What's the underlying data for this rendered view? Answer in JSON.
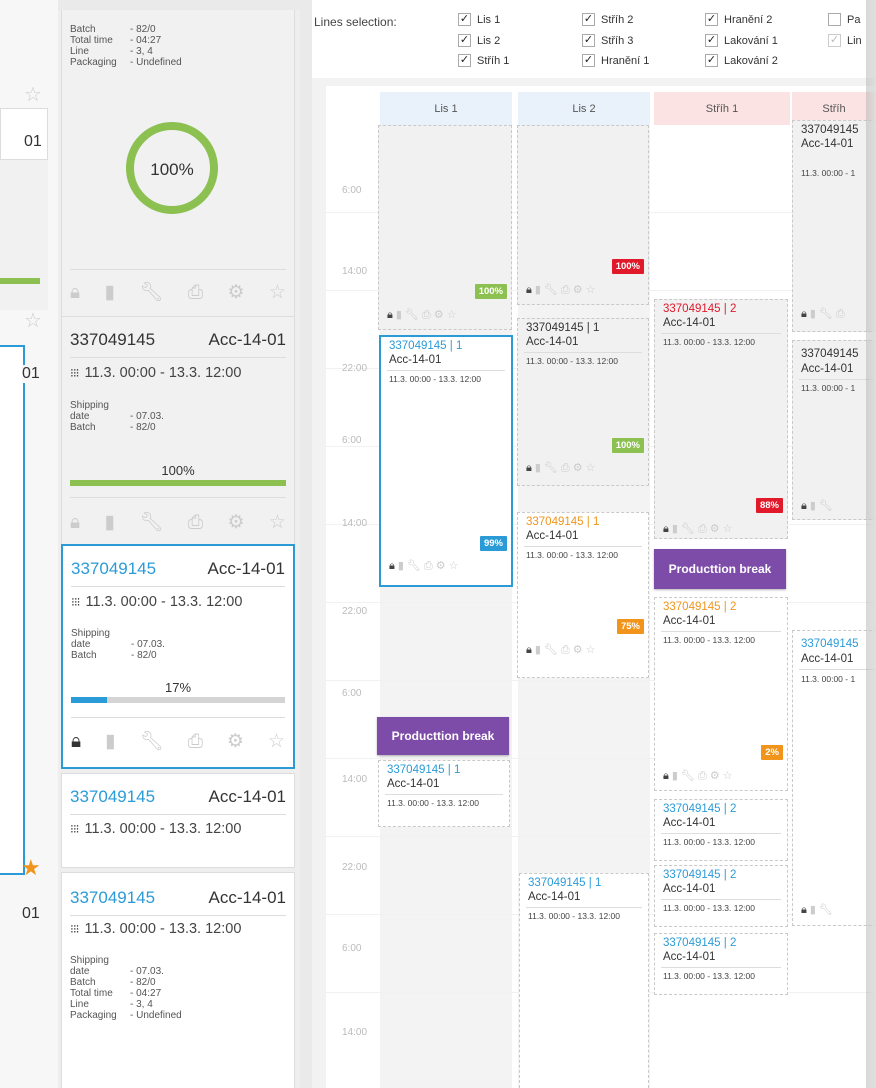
{
  "colors": {
    "blue": "#2b9bd8",
    "green": "#8cc152",
    "red": "#e0192b",
    "orange": "#f0941c",
    "purple": "#7d4ca9"
  },
  "icons": {
    "lock": "lock-icon",
    "clipboard": "clipboard-icon",
    "wrench": "wrench-icon",
    "print": "printer-icon",
    "gear": "gear-icon",
    "star": "star-icon",
    "grid": "grid-icon",
    "check": "check-icon"
  },
  "left_edge": {
    "top_snip": "01",
    "mid_snip": "01",
    "bot_snip": "01"
  },
  "orders": [
    {
      "kv": [
        [
          "Batch",
          "- 82/0"
        ],
        [
          "Total time",
          "- 04:27"
        ],
        [
          "Line",
          "- 3, 4"
        ],
        [
          "Packaging",
          "- Undefined"
        ]
      ],
      "progress": 1.0,
      "pct_label": "100%"
    },
    {
      "number": "337049145",
      "acc": "Acc-14-01",
      "dt": "11.3. 00:00 - 13.3. 12:00",
      "kv": [
        [
          "Shipping date",
          "- 07.03."
        ],
        [
          "Batch",
          "- 82/0"
        ]
      ],
      "progress": 1.0,
      "pct_label": "100%"
    },
    {
      "number": "337049145",
      "acc": "Acc-14-01",
      "dt": "11.3. 00:00 - 13.3. 12:00",
      "kv": [
        [
          "Shipping date",
          "- 07.03."
        ],
        [
          "Batch",
          "- 82/0"
        ]
      ],
      "progress": 0.17,
      "pct_label": "17%"
    },
    {
      "number": "337049145",
      "acc": "Acc-14-01",
      "dt": "11.3. 00:00 - 13.3. 12:00"
    },
    {
      "number": "337049145",
      "acc": "Acc-14-01",
      "dt": "11.3. 00:00 - 13.3. 12:00",
      "kv": [
        [
          "Shipping date",
          "- 07.03."
        ],
        [
          "Batch",
          "- 82/0"
        ],
        [
          "Total time",
          "- 04:27"
        ],
        [
          "Line",
          "- 3, 4"
        ],
        [
          "Packaging",
          "- Undefined"
        ]
      ]
    }
  ],
  "lines_selection": {
    "label": "Lines selection:",
    "items": [
      {
        "label": "Lis 1",
        "checked": true
      },
      {
        "label": "Lis 2",
        "checked": true
      },
      {
        "label": "Stříh 1",
        "checked": true
      },
      {
        "label": "Stříh 2",
        "checked": true
      },
      {
        "label": "Stříh 3",
        "checked": true
      },
      {
        "label": "Hranění 1",
        "checked": true
      },
      {
        "label": "Hranění 2",
        "checked": true
      },
      {
        "label": "Lakování 1",
        "checked": true
      },
      {
        "label": "Lakování 2",
        "checked": true
      },
      {
        "label": "Pa",
        "checked": false
      },
      {
        "label": "Lin",
        "checked": true
      }
    ]
  },
  "columns": [
    {
      "name": "Lis 1",
      "color": "#e9f2fb"
    },
    {
      "name": "Lis 2",
      "color": "#e9f2fb"
    },
    {
      "name": "Stříh 1",
      "color": "#fbe3e3"
    },
    {
      "name": "Stříh",
      "color": "#fbe3e3"
    }
  ],
  "times": [
    "6:00",
    "14:00",
    "22:00",
    "6:00",
    "14:00",
    "22:00",
    "6:00",
    "14:00",
    "22:00",
    "6:00",
    "14:00"
  ],
  "blocks": [
    {
      "num": "337049145",
      "sub": "Acc-14-01",
      "dt": "11.3. 00:00 - 1"
    },
    {
      "badge": "100%",
      "badge_color": "#8cc152"
    },
    {
      "badge": "100%",
      "badge_color": "#e0192b"
    },
    {
      "num": "337049145 | 2",
      "sub": "Acc-14-01",
      "dt": "11.3. 00:00 - 13.3. 12:00",
      "badge": "88%",
      "badge_color": "#e0192b"
    },
    {
      "num": "337049145 | 1",
      "sub": "Acc-14-01",
      "dt": "11.3. 00:00 - 13.3. 12:00",
      "badge": "100%",
      "badge_color": "#8cc152"
    },
    {
      "num": "337049145",
      "sub": "Acc-14-01",
      "dt": "11.3. 00:00 - 1"
    },
    {
      "num": "337049145 | 1",
      "sub": "Acc-14-01",
      "dt": "11.3. 00:00 - 13.3. 12:00",
      "badge": "99%",
      "badge_color": "#2b9bd8"
    },
    {
      "num": "337049145 | 1",
      "sub": "Acc-14-01",
      "dt": "11.3. 00:00 - 13.3. 12:00",
      "badge": "75%",
      "badge_color": "#f0941c"
    },
    {
      "num": "337049145 | 2",
      "sub": "Acc-14-01",
      "dt": "11.3. 00:00 - 13.3. 12:00",
      "badge": "2%",
      "badge_color": "#f0941c"
    },
    {
      "num": "337049145",
      "sub": "Acc-14-01",
      "dt": "11.3. 00:00 - 1"
    },
    {
      "num": "337049145 | 1",
      "sub": "Acc-14-01",
      "dt": "11.3. 00:00 - 13.3. 12:00"
    },
    {
      "num": "337049145 | 2",
      "sub": "Acc-14-01",
      "dt": "11.3. 00:00 - 13.3. 12:00"
    },
    {
      "num": "337049145 | 2",
      "sub": "Acc-14-01",
      "dt": "11.3. 00:00 - 13.3. 12:00"
    },
    {
      "num": "337049145 | 1",
      "sub": "Acc-14-01",
      "dt": "11.3. 00:00 - 13.3. 12:00"
    },
    {
      "num": "337049145 | 2",
      "sub": "Acc-14-01",
      "dt": "11.3. 00:00 - 13.3. 12:00"
    }
  ],
  "breaks": [
    "Producttion break",
    "Producttion break"
  ]
}
